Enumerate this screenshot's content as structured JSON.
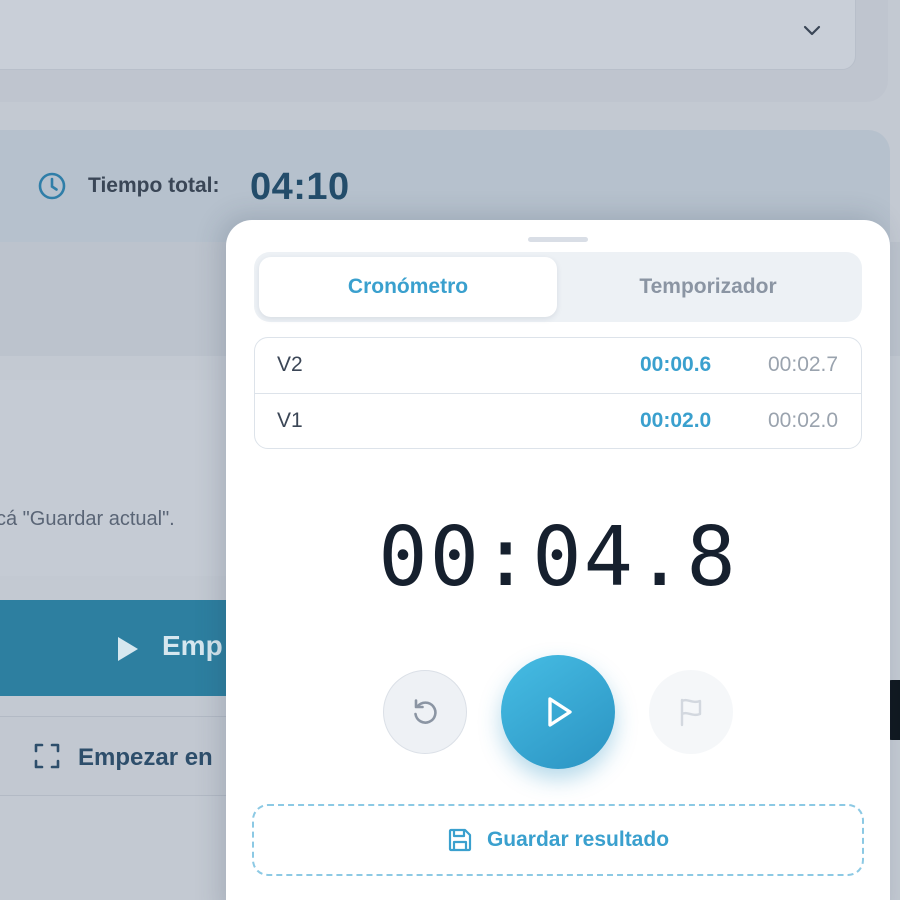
{
  "background": {
    "total_time_label": "Tiempo total:",
    "total_time_value": "04:10",
    "instruction_text": "cá \"Guardar actual\".",
    "start_button_label": "Emp",
    "fullscreen_button_label": "Empezar en"
  },
  "sheet": {
    "tabs": [
      {
        "label": "Cronómetro",
        "active": true
      },
      {
        "label": "Temporizador",
        "active": false
      }
    ],
    "laps": [
      {
        "name": "V2",
        "split": "00:00.6",
        "total": "00:02.7"
      },
      {
        "name": "V1",
        "split": "00:02.0",
        "total": "00:02.0"
      }
    ],
    "timer_display": "00:04.8",
    "controls": {
      "reset_icon": "reset-icon",
      "play_icon": "play-icon",
      "lap_icon": "flag-icon"
    },
    "save_button_label": "Guardar resultado"
  },
  "colors": {
    "accent": "#3aa0ce",
    "play_gradient_start": "#46bde4",
    "play_gradient_end": "#2b93c2",
    "timer_text": "#16202e"
  }
}
